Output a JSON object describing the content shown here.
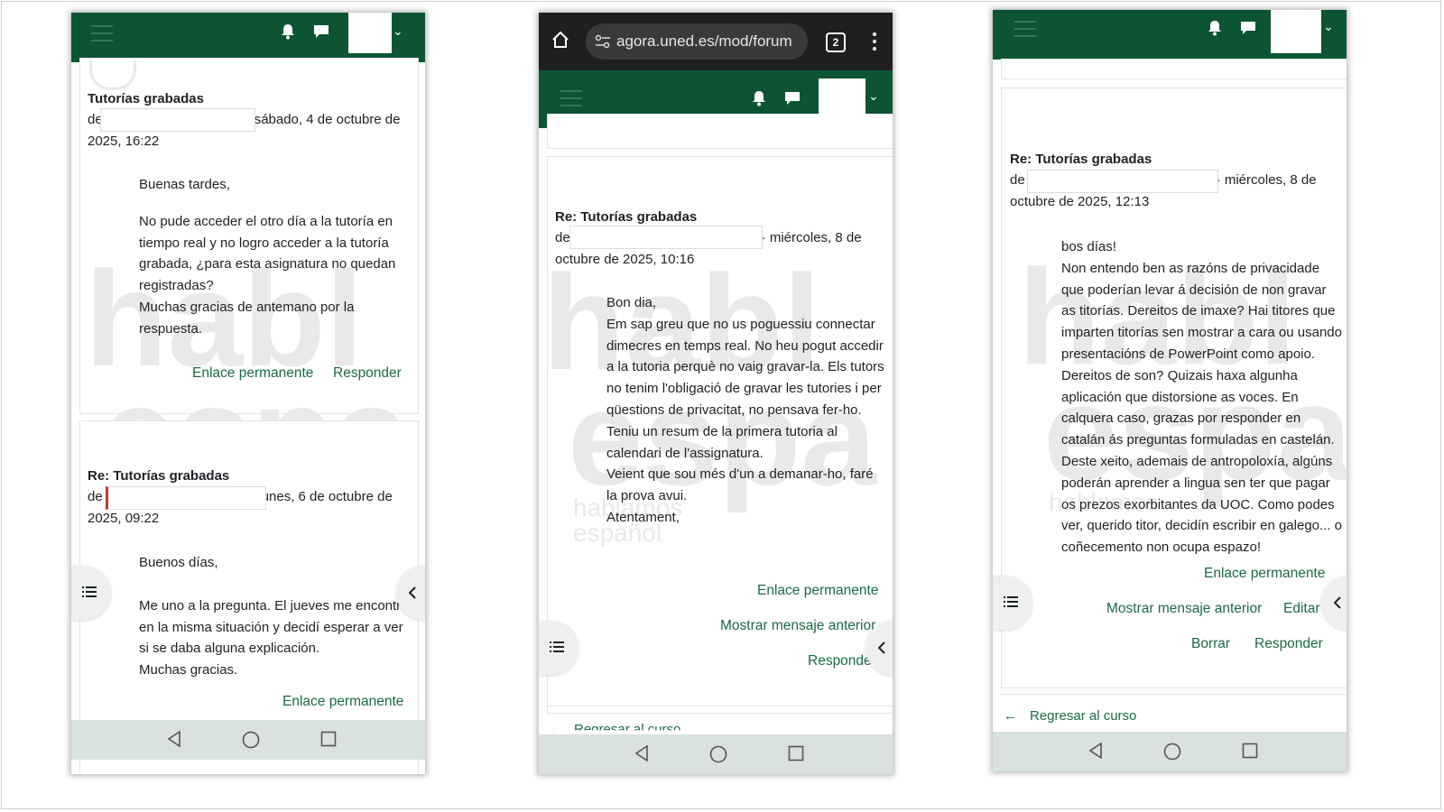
{
  "phone1": {
    "post1": {
      "title": "Tutorías grabadas",
      "by_prefix": "de",
      "meta_suffix": "sábado, 4 de octubre de",
      "meta_line2": "2025, 16:22",
      "greeting": "Buenas tardes,",
      "body": "No pude acceder el otro día a la tutoría en tiempo real y no logro acceder a la tutoría grabada, ¿para esta asignatura no quedan registradas?",
      "closing": "Muchas gracias de antemano por la respuesta.",
      "permalink": "Enlace permanente",
      "reply": "Responder"
    },
    "post2": {
      "title": "Re: Tutorías grabadas",
      "by_prefix": "de",
      "meta_suffix": "unes, 6 de octubre de",
      "meta_line2": "2025, 09:22",
      "greeting": "Buenos días,",
      "body": "Me uno a la pregunta. El jueves me encontre en la misma situación y decidí esperar a ver si se daba alguna explicación.",
      "closing": "Muchas gracias.",
      "permalink": "Enlace permanente"
    }
  },
  "phone2": {
    "url": "agora.uned.es/mod/forum",
    "tab_count": "2",
    "post": {
      "title": "Re: Tutorías grabadas",
      "by_prefix": "de",
      "meta_suffix": "· miércoles, 8 de",
      "meta_line2": "octubre de 2025, 10:16",
      "greeting": "Bon dia,",
      "body": "Em sap greu que no us poguessiu connectar dimecres en temps real. No heu pogut accedir a la tutoria perquè no vaig gravar-la. Els tutors no tenim l'obligació de gravar les tutories i per qüestions de privacitat, no pensava fer-ho. Teniu un resum de la primera tutoria al calendari de l'assignatura.",
      "body2": "Veient que sou més d'un a demanar-ho, faré la prova avui.",
      "closing": "Atentament,",
      "permalink": "Enlace permanente",
      "show_previous": "Mostrar mensaje anterior",
      "reply": "Responder",
      "back": "Regresar al curso"
    }
  },
  "phone3": {
    "post": {
      "title": "Re: Tutorías grabadas",
      "by_prefix": "de",
      "meta_suffix": "· miércoles, 8 de",
      "meta_line2": "octubre de 2025, 12:13",
      "greeting": "bos días!",
      "body": "Non entendo ben as razóns de privacidade que poderían levar á decisión de non gravar as titorías. Dereitos de imaxe? Hai titores que imparten titorías sen mostrar a cara ou usando presentacións de PowerPoint como apoio. Dereitos de son? Quizais haxa algunha aplicación que distorsione as voces. En calquera caso, grazas por responder en catalán ás preguntas formuladas en castelán. Deste xeito, ademais de antropoloxía, algúns poderán aprender a lingua sen ter que pagar os prezos exorbitantes da UOC. Como podes ver, querido titor, decidín escribir en galego... o coñecemento non ocupa espazo!",
      "permalink": "Enlace permanente",
      "show_previous": "Mostrar mensaje anterior",
      "edit": "Editar",
      "delete": "Borrar",
      "reply": "Responder",
      "back": "Regresar al curso"
    }
  },
  "watermark": {
    "big1": "habl",
    "big2": "espa",
    "small1": "hablamos",
    "small2": "español"
  },
  "colors": {
    "navbar": "#0d5433",
    "link": "#1a6b45",
    "android_bar": "#d9e2dd",
    "chrome": "#1f1f1f"
  }
}
